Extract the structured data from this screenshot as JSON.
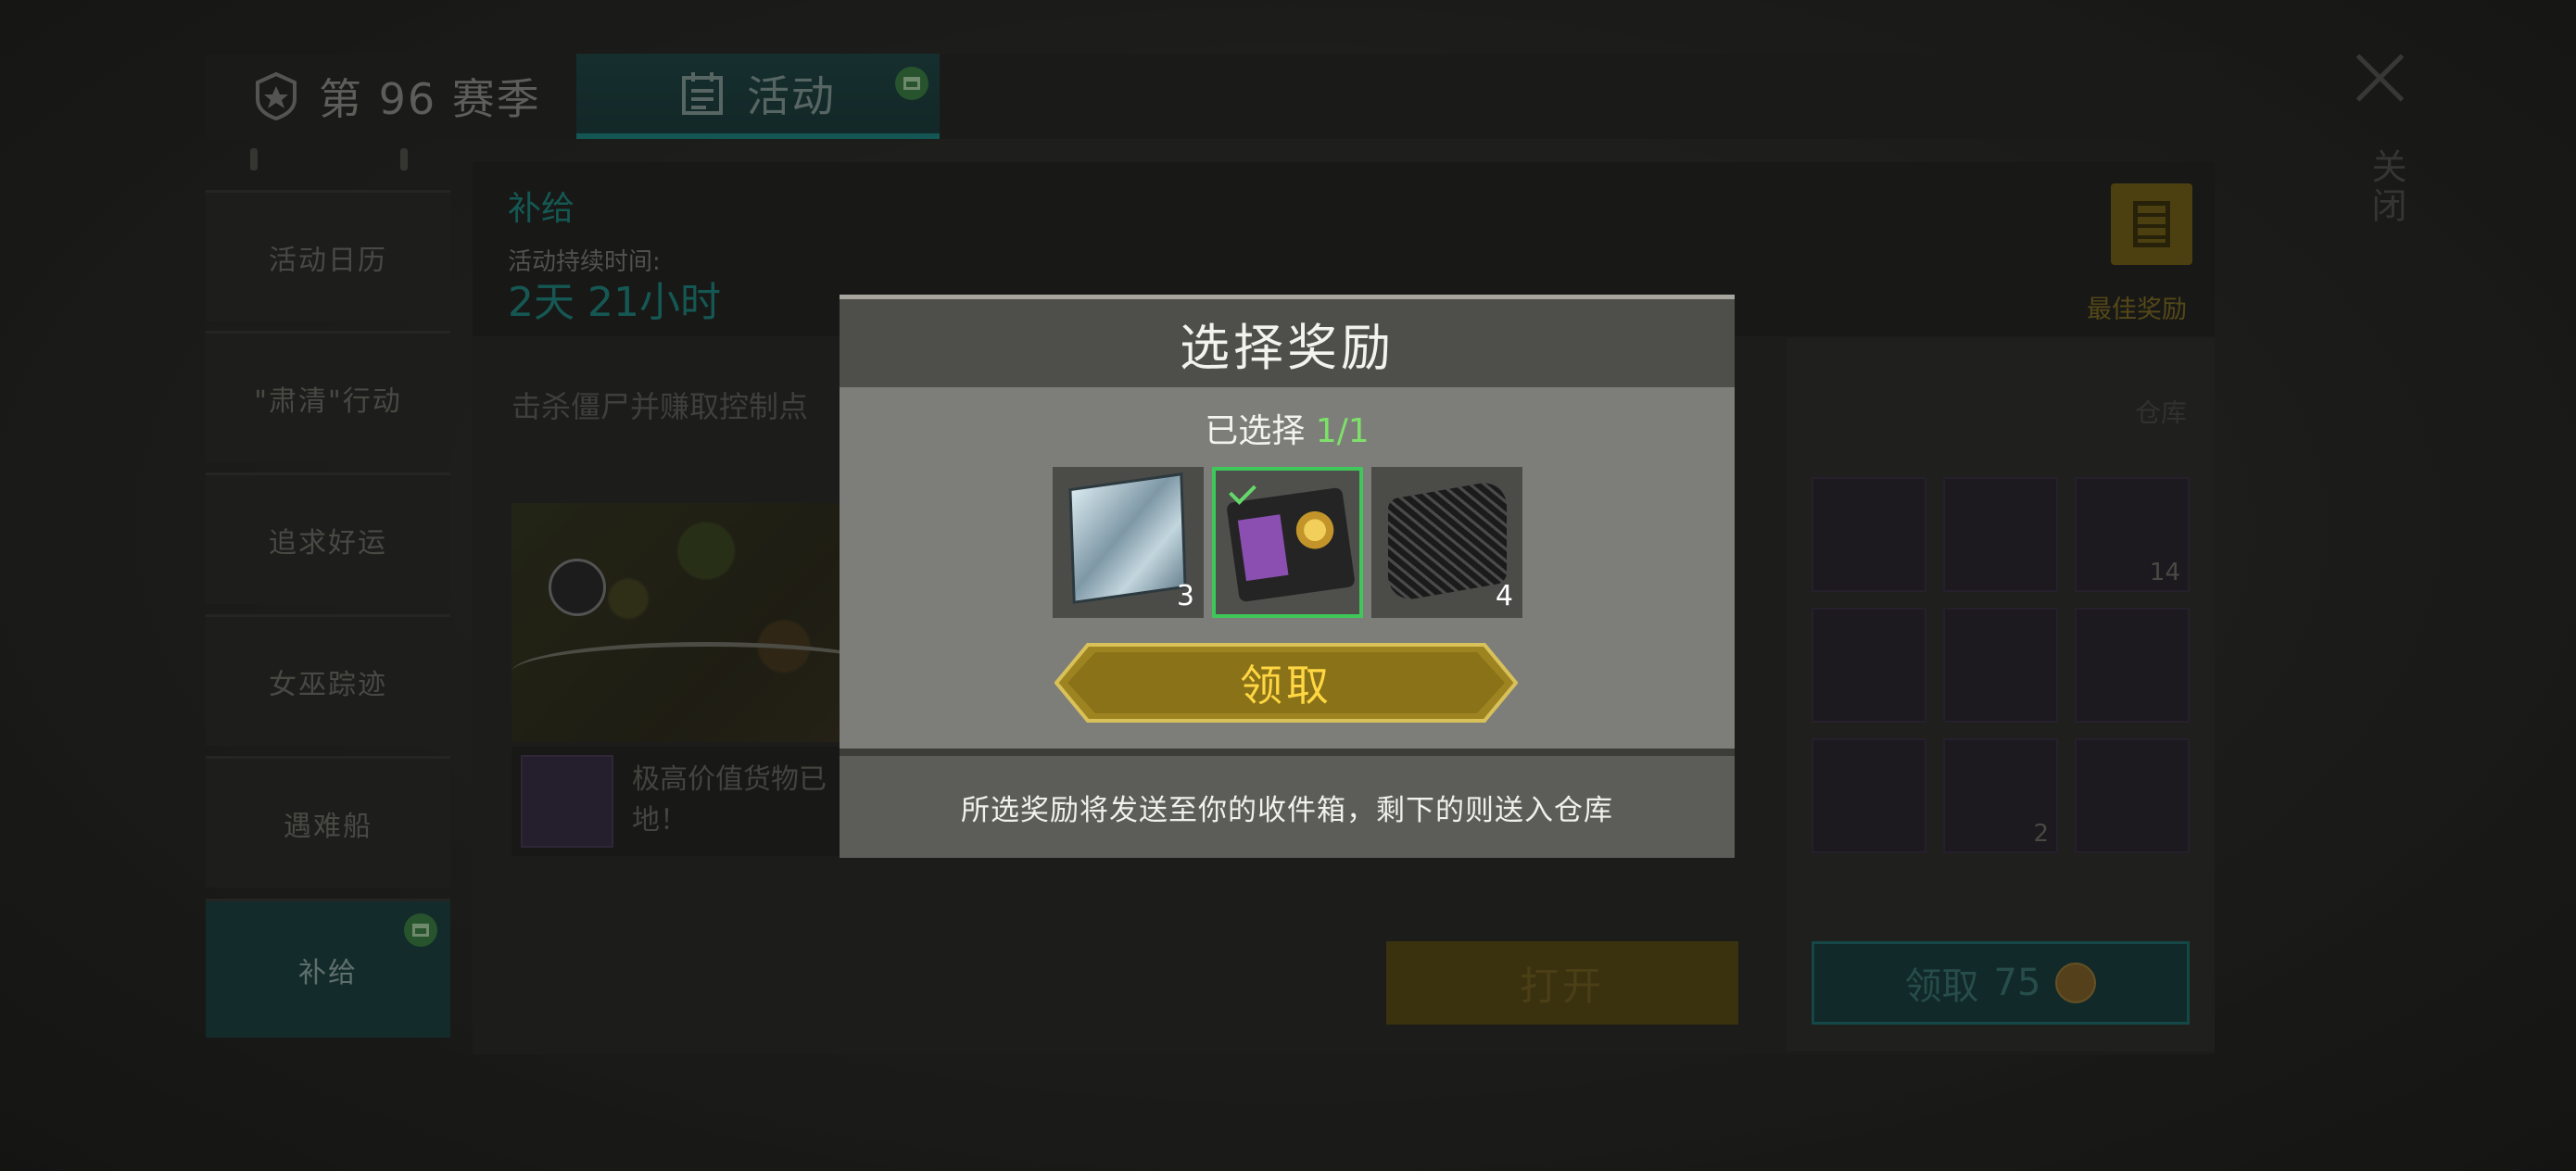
{
  "tabs": {
    "season": "第 96 赛季",
    "activity": "活动"
  },
  "sidebar": {
    "items": [
      {
        "label": "活动日历"
      },
      {
        "label": "\"肃清\"行动"
      },
      {
        "label": "追求好运"
      },
      {
        "label": "女巫踪迹"
      },
      {
        "label": "遇难船"
      },
      {
        "label": "补给",
        "active": true
      }
    ]
  },
  "event": {
    "title": "补给",
    "duration_label": "活动持续时间:",
    "duration_value": "2天 21小时",
    "best_reward_label": "最佳奖励",
    "description": "击杀僵尸并赚取控制点",
    "cargo_text_line1": "极高价值货物已",
    "cargo_text_line2": "地！",
    "open_button": "打开"
  },
  "storage": {
    "title": "仓库",
    "slots": [
      {
        "icon": "rifle-icon",
        "count": ""
      },
      {
        "icon": "shotgun-icon",
        "count": ""
      },
      {
        "icon": "notebook-icon",
        "count": "14"
      },
      {
        "icon": "helmet-icon",
        "count": ""
      },
      {
        "icon": "syringe-gun-icon",
        "count": ""
      },
      {
        "icon": "bag-icon",
        "count": ""
      },
      {
        "icon": "vest-icon",
        "count": ""
      },
      {
        "icon": "pills-icon",
        "count": "2"
      },
      {
        "icon": "bag-icon",
        "count": ""
      }
    ],
    "claim_button": "领取",
    "claim_cost": "75"
  },
  "close": {
    "label": "关闭"
  },
  "modal": {
    "title": "选择奖励",
    "selected_prefix": "已选择",
    "selected_count": "1/1",
    "rewards": [
      {
        "icon": "metal-plate-icon",
        "count": "3",
        "selected": false
      },
      {
        "icon": "police-badge-wallet-icon",
        "count": "",
        "selected": true
      },
      {
        "icon": "carbon-mesh-icon",
        "count": "4",
        "selected": false
      }
    ],
    "claim_button": "领取",
    "note": "所选奖励将发送至你的收件箱，剩下的则送入仓库"
  },
  "colors": {
    "accent_teal": "#1e9189",
    "gold": "#ffd742",
    "select_green": "#3fc85a"
  }
}
